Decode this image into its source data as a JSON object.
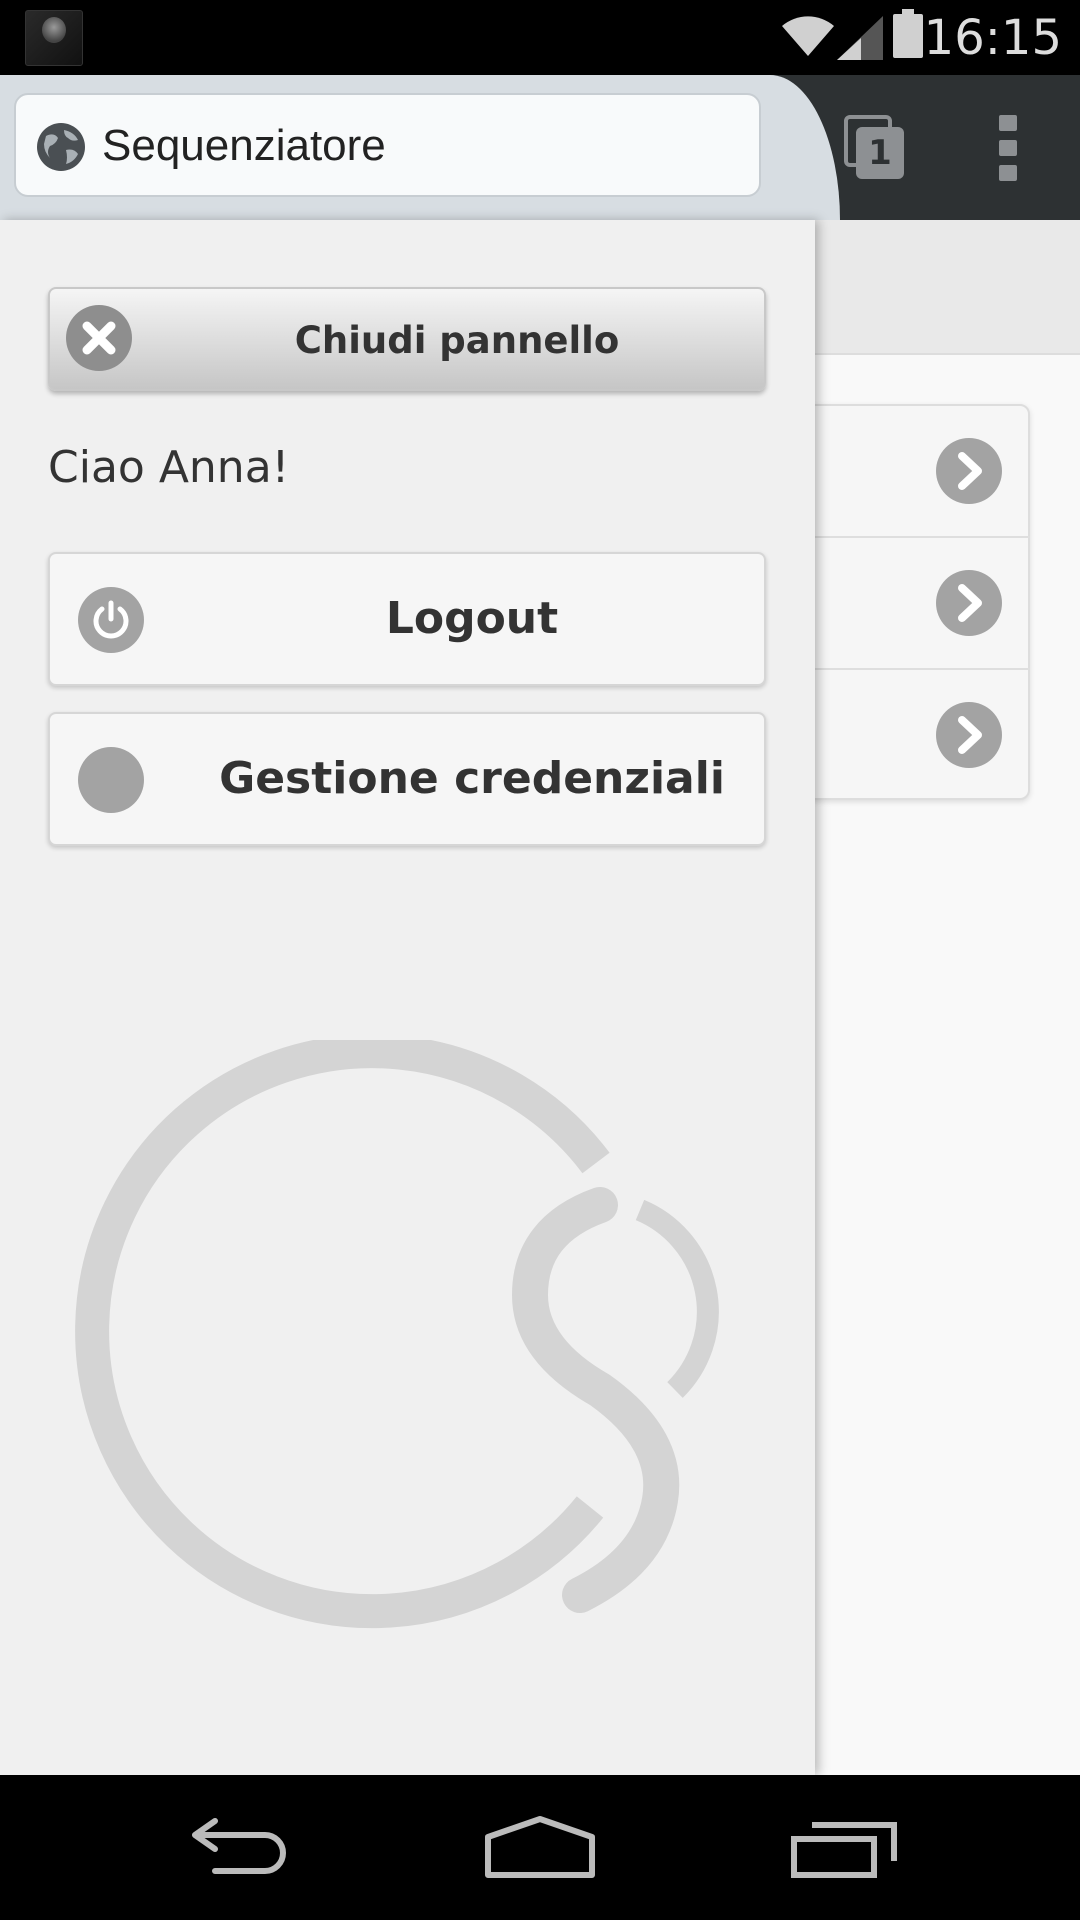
{
  "status_bar": {
    "time": "16:15",
    "icons": [
      "notification-thumbnail",
      "wifi-icon",
      "signal-icon",
      "battery-icon"
    ]
  },
  "browser": {
    "url_text": "Sequenziatore",
    "tab_count": "1",
    "icons": [
      "globe-icon",
      "tabs-icon",
      "overflow-menu-icon"
    ]
  },
  "panel": {
    "close_label": "Chiudi pannello",
    "greeting": "Ciao Anna!",
    "logout_label": "Logout",
    "credentials_label": "Gestione credenziali"
  },
  "background_list": {
    "rows": 3,
    "icon": "chevron-right-icon"
  },
  "colors": {
    "panel_bg": "#f0f0f0",
    "icon_gray": "#a3a3a3",
    "chrome_dark": "#2d3133",
    "chrome_tab": "#d7dde2"
  }
}
